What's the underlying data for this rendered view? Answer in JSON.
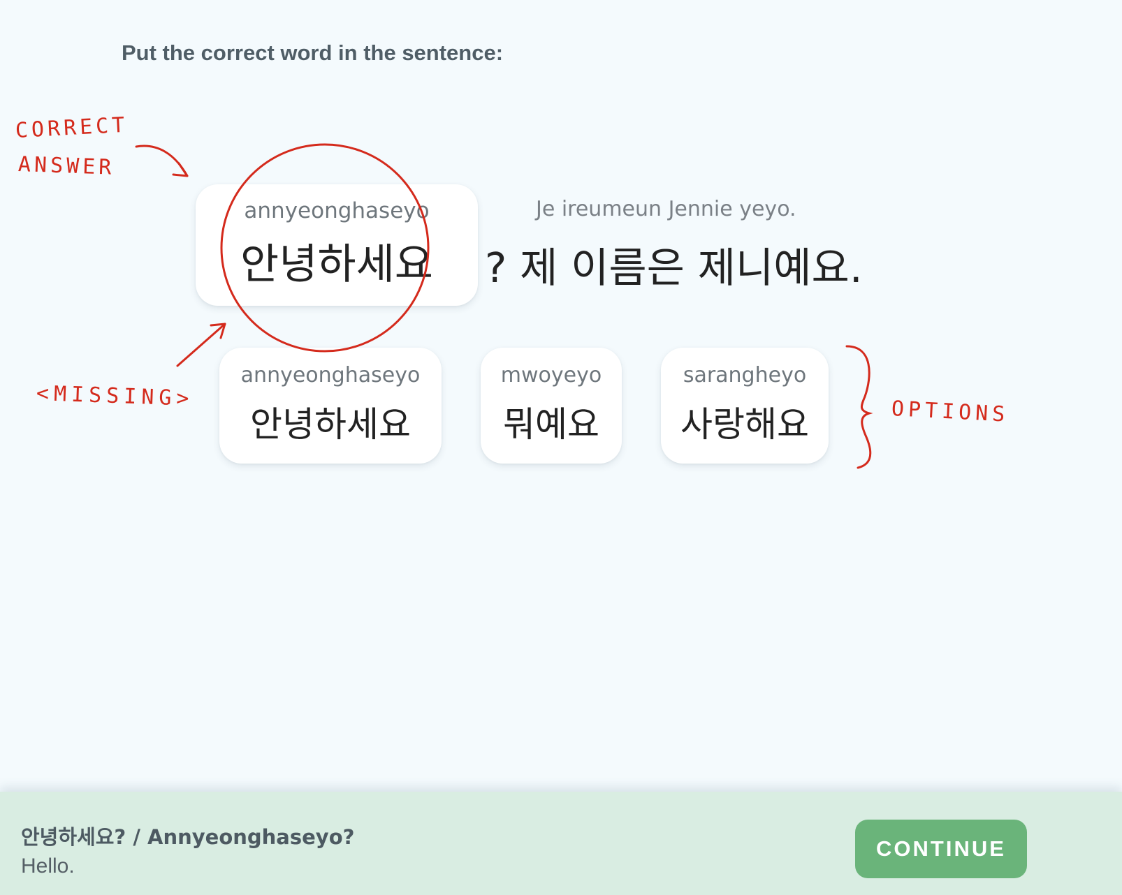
{
  "instruction": "Put the correct word in the sentence:",
  "answer_slot": {
    "romanization": "annyeonghaseyo",
    "korean": "안녕하세요"
  },
  "sentence": {
    "romanization": "Je ireumeun Jennie yeyo.",
    "korean": "? 제 이름은 제니예요."
  },
  "options": [
    {
      "romanization": "annyeonghaseyo",
      "korean": "안녕하세요"
    },
    {
      "romanization": "mwoyeyo",
      "korean": "뭐예요"
    },
    {
      "romanization": "sarangheyo",
      "korean": "사랑해요"
    }
  ],
  "annotations": {
    "correct_line1": "CORRECT",
    "correct_line2": "ANSWER",
    "missing": "<MISSING>",
    "options": "OPTIONS",
    "color": "#d42a1c"
  },
  "feedback": {
    "title": "안녕하세요? / Annyeonghaseyo?",
    "translation": "Hello.",
    "continue_label": "CONTINUE",
    "bar_color": "#d9ede2",
    "button_color": "#6ab47a"
  }
}
